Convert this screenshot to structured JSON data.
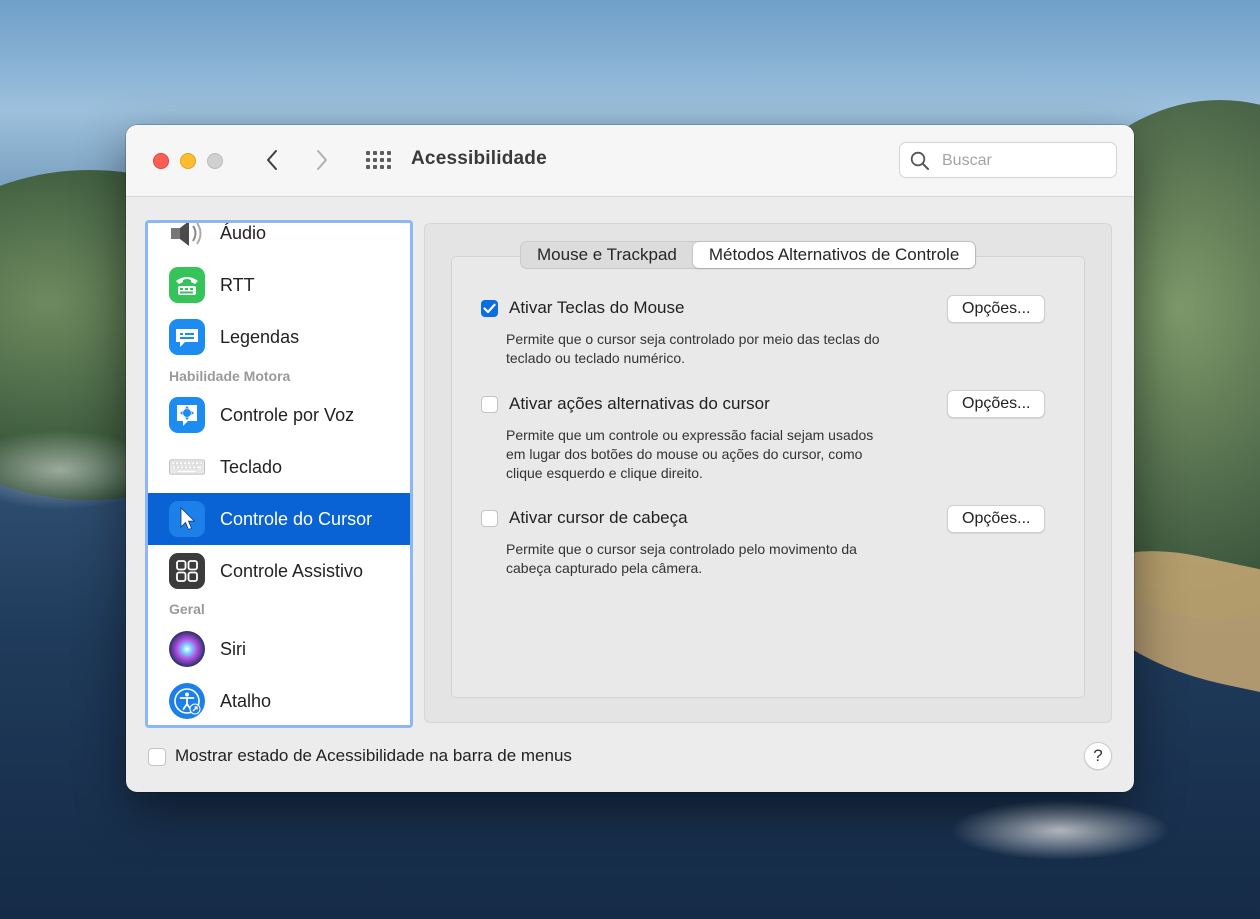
{
  "window": {
    "title": "Acessibilidade",
    "search_placeholder": "Buscar"
  },
  "sidebar": {
    "items": [
      {
        "label": "Áudio",
        "icon": "speaker-icon"
      },
      {
        "label": "RTT",
        "icon": "tty-phone-icon"
      },
      {
        "label": "Legendas",
        "icon": "captions-icon"
      },
      {
        "label": "Controle por Voz",
        "icon": "voice-control-icon"
      },
      {
        "label": "Teclado",
        "icon": "keyboard-icon"
      },
      {
        "label": "Controle do Cursor",
        "icon": "pointer-icon",
        "selected": true
      },
      {
        "label": "Controle Assistivo",
        "icon": "switch-control-icon"
      },
      {
        "label": "Siri",
        "icon": "siri-icon"
      },
      {
        "label": "Atalho",
        "icon": "accessibility-shortcut-icon"
      }
    ],
    "headers": {
      "motor": "Habilidade Motora",
      "general": "Geral"
    }
  },
  "tabs": [
    {
      "label": "Mouse e Trackpad",
      "active": false
    },
    {
      "label": "Métodos Alternativos de Controle",
      "active": true
    }
  ],
  "options": [
    {
      "label": "Ativar Teclas do Mouse",
      "checked": true,
      "button": "Opções...",
      "description": "Permite que o cursor seja controlado por meio das teclas do teclado ou teclado numérico."
    },
    {
      "label": "Ativar ações alternativas do cursor",
      "checked": false,
      "button": "Opções...",
      "description": "Permite que um controle ou expressão facial sejam usados em lugar dos botões do mouse ou ações do cursor, como clique esquerdo e clique direito."
    },
    {
      "label": "Ativar cursor de cabeça",
      "checked": false,
      "button": "Opções...",
      "description": "Permite que o cursor seja controlado pelo movimento da cabeça capturado pela câmera."
    }
  ],
  "footer": {
    "checkbox_label": "Mostrar estado de Acessibilidade na barra de menus",
    "checked": false,
    "help_label": "?"
  },
  "colors": {
    "selection": "#0a63d4",
    "checkbox_checked": "#0a6ee0",
    "close": "#fe5f57",
    "minimize": "#febc2e"
  }
}
